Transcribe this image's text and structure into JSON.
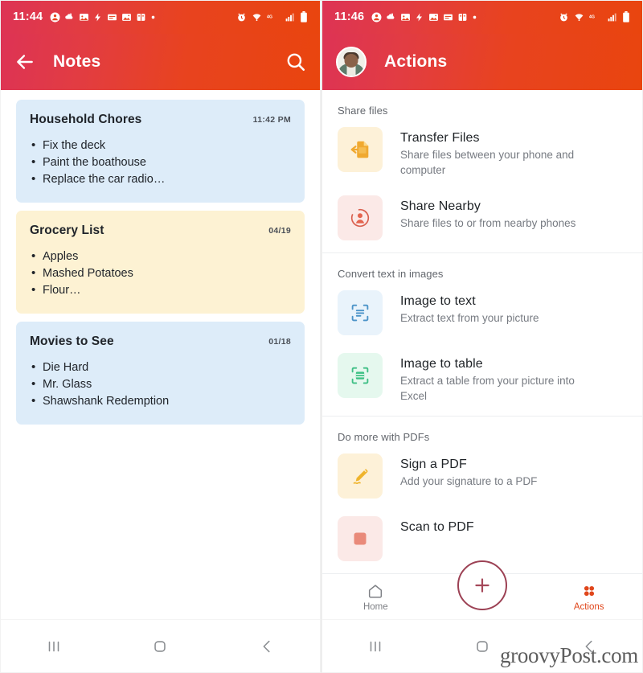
{
  "colors": {
    "header_gradient_start": "#dd3355",
    "header_gradient_end": "#e9450e",
    "accent": "#e0461b",
    "fab_ring": "#9c4154",
    "note_blue": "#ddecf9",
    "note_yellow": "#fdf2d3"
  },
  "notes_screen": {
    "status_bar": {
      "clock": "11:44",
      "left_icons": [
        "account-icon",
        "weather-icon",
        "photos-icon",
        "flash-icon",
        "message-icon",
        "gallery-icon",
        "book-icon",
        "dot-icon"
      ],
      "right_icons": [
        "alarm-icon",
        "wifi-icon",
        "network-speed-icon",
        "signal-icon",
        "battery-icon"
      ]
    },
    "app_bar": {
      "back_icon": "back-arrow-icon",
      "title": "Notes",
      "search_icon": "search-icon"
    },
    "notes": [
      {
        "title": "Household Chores",
        "stamp": "11:42 PM",
        "color": "blue",
        "items": [
          "Fix the deck",
          "Paint the boathouse",
          "Replace the car radio…"
        ]
      },
      {
        "title": "Grocery List",
        "stamp": "04/19",
        "color": "yellow",
        "items": [
          "Apples",
          "Mashed Potatoes",
          "Flour…"
        ]
      },
      {
        "title": "Movies to See",
        "stamp": "01/18",
        "color": "blue",
        "items": [
          "Die Hard",
          "Mr. Glass",
          "Shawshank Redemption"
        ]
      }
    ],
    "system_nav": [
      "recents-icon",
      "home-icon",
      "back-icon"
    ]
  },
  "actions_screen": {
    "status_bar": {
      "clock": "11:46",
      "left_icons": [
        "account-icon",
        "weather-icon",
        "photos-icon",
        "flash-icon",
        "gallery-icon",
        "message-icon",
        "book-icon",
        "dot-icon"
      ],
      "right_icons": [
        "alarm-icon",
        "wifi-icon",
        "network-speed-icon",
        "signal-icon",
        "battery-icon"
      ]
    },
    "app_bar": {
      "avatar": "user-avatar",
      "title": "Actions"
    },
    "sections": [
      {
        "title": "Share files",
        "rows": [
          {
            "title": "Transfer Files",
            "subtitle": "Share files between your phone and computer",
            "icon": "transfer-files-icon",
            "icon_bg": "amber"
          },
          {
            "title": "Share Nearby",
            "subtitle": "Share files to or from nearby phones",
            "icon": "share-nearby-icon",
            "icon_bg": "pink"
          }
        ]
      },
      {
        "title": "Convert text in images",
        "rows": [
          {
            "title": "Image to text",
            "subtitle": "Extract text from your picture",
            "icon": "image-to-text-icon",
            "icon_bg": "blue"
          },
          {
            "title": "Image to table",
            "subtitle": "Extract a table from your picture into Excel",
            "icon": "image-to-table-icon",
            "icon_bg": "green"
          }
        ]
      },
      {
        "title": "Do more with PDFs",
        "rows": [
          {
            "title": "Sign a PDF",
            "subtitle": "Add your signature to a PDF",
            "icon": "sign-pdf-icon",
            "icon_bg": "amber"
          },
          {
            "title": "Scan to PDF",
            "subtitle": "",
            "icon": "scan-pdf-icon",
            "icon_bg": "pink"
          }
        ]
      }
    ],
    "bottom_nav": {
      "home_label": "Home",
      "home_icon": "home-icon",
      "fab_icon": "plus-icon",
      "actions_label": "Actions",
      "actions_icon": "grid-dots-icon"
    },
    "system_nav": [
      "recents-icon",
      "home-icon",
      "back-icon"
    ]
  },
  "watermark": "groovyPost.com"
}
